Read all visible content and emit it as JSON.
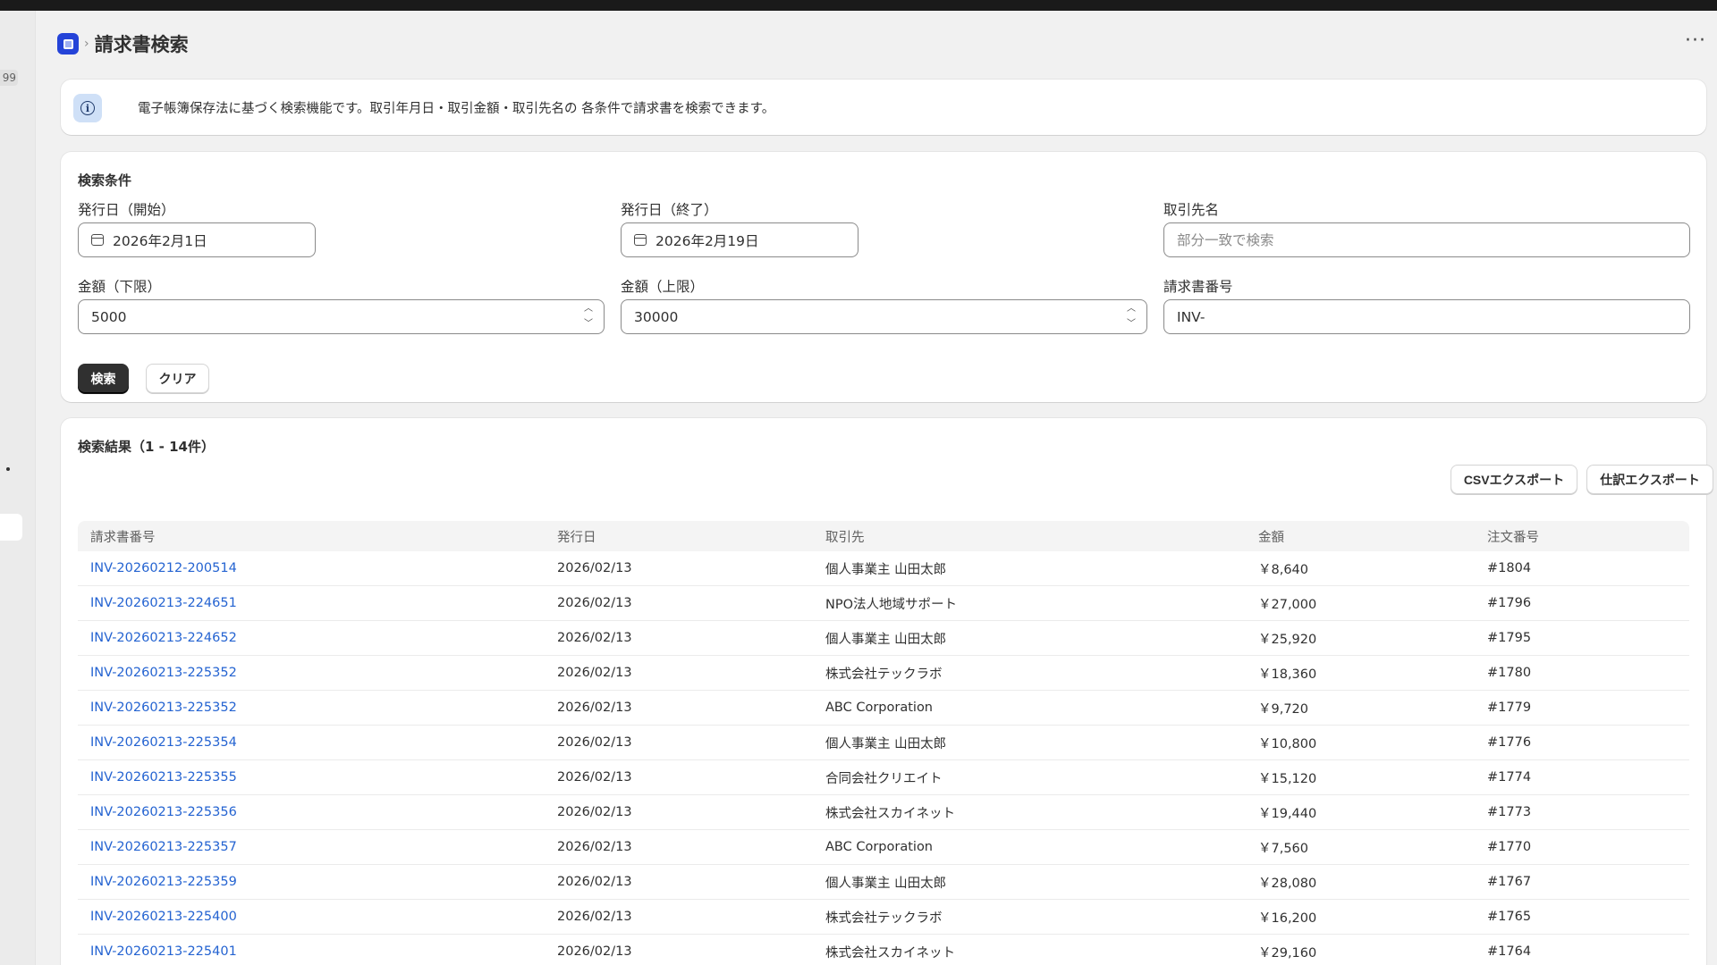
{
  "header": {
    "title": "請求書検索"
  },
  "sidebar": {
    "badge": "99"
  },
  "banner": {
    "text": "電子帳簿保存法に基づく検索機能です。取引年月日・取引金額・取引先名の 各条件で請求書を検索できます。"
  },
  "search": {
    "title": "検索条件",
    "date_start": {
      "label": "発行日（開始）",
      "value": "2026年2月1日"
    },
    "date_end": {
      "label": "発行日（終了）",
      "value": "2026年2月19日"
    },
    "client": {
      "label": "取引先名",
      "placeholder": "部分一致で検索",
      "value": ""
    },
    "amount_min": {
      "label": "金額（下限）",
      "value": "5000"
    },
    "amount_max": {
      "label": "金額（上限）",
      "value": "30000"
    },
    "invoice_no": {
      "label": "請求書番号",
      "value": "INV-"
    },
    "search_button": "検索",
    "clear_button": "クリア"
  },
  "results": {
    "title": "検索結果（1 - 14件）",
    "csv_export": "CSVエクスポート",
    "journal_export": "仕訳エクスポート",
    "columns": [
      "請求書番号",
      "発行日",
      "取引先",
      "金額",
      "注文番号"
    ],
    "rows": [
      {
        "invoice": "INV-20260212-200514",
        "date": "2026/02/13",
        "client": "個人事業主 山田太郎",
        "amount": "￥8,640",
        "order": "#1804"
      },
      {
        "invoice": "INV-20260213-224651",
        "date": "2026/02/13",
        "client": "NPO法人地域サポート",
        "amount": "￥27,000",
        "order": "#1796"
      },
      {
        "invoice": "INV-20260213-224652",
        "date": "2026/02/13",
        "client": "個人事業主 山田太郎",
        "amount": "￥25,920",
        "order": "#1795"
      },
      {
        "invoice": "INV-20260213-225352",
        "date": "2026/02/13",
        "client": "株式会社テックラボ",
        "amount": "￥18,360",
        "order": "#1780"
      },
      {
        "invoice": "INV-20260213-225352",
        "date": "2026/02/13",
        "client": "ABC Corporation",
        "amount": "￥9,720",
        "order": "#1779"
      },
      {
        "invoice": "INV-20260213-225354",
        "date": "2026/02/13",
        "client": "個人事業主 山田太郎",
        "amount": "￥10,800",
        "order": "#1776"
      },
      {
        "invoice": "INV-20260213-225355",
        "date": "2026/02/13",
        "client": "合同会社クリエイト",
        "amount": "￥15,120",
        "order": "#1774"
      },
      {
        "invoice": "INV-20260213-225356",
        "date": "2026/02/13",
        "client": "株式会社スカイネット",
        "amount": "￥19,440",
        "order": "#1773"
      },
      {
        "invoice": "INV-20260213-225357",
        "date": "2026/02/13",
        "client": "ABC Corporation",
        "amount": "￥7,560",
        "order": "#1770"
      },
      {
        "invoice": "INV-20260213-225359",
        "date": "2026/02/13",
        "client": "個人事業主 山田太郎",
        "amount": "￥28,080",
        "order": "#1767"
      },
      {
        "invoice": "INV-20260213-225400",
        "date": "2026/02/13",
        "client": "株式会社テックラボ",
        "amount": "￥16,200",
        "order": "#1765"
      },
      {
        "invoice": "INV-20260213-225401",
        "date": "2026/02/13",
        "client": "株式会社スカイネット",
        "amount": "￥29,160",
        "order": "#1764"
      }
    ]
  },
  "colors": {
    "brand": "#2443d8",
    "link": "#2463d1",
    "primary_button": "#303030"
  },
  "icons": {
    "app": "app-icon",
    "info": "info-icon",
    "calendar": "calendar-icon",
    "more": "more-icon",
    "breadcrumb": "chevron-right-icon"
  }
}
